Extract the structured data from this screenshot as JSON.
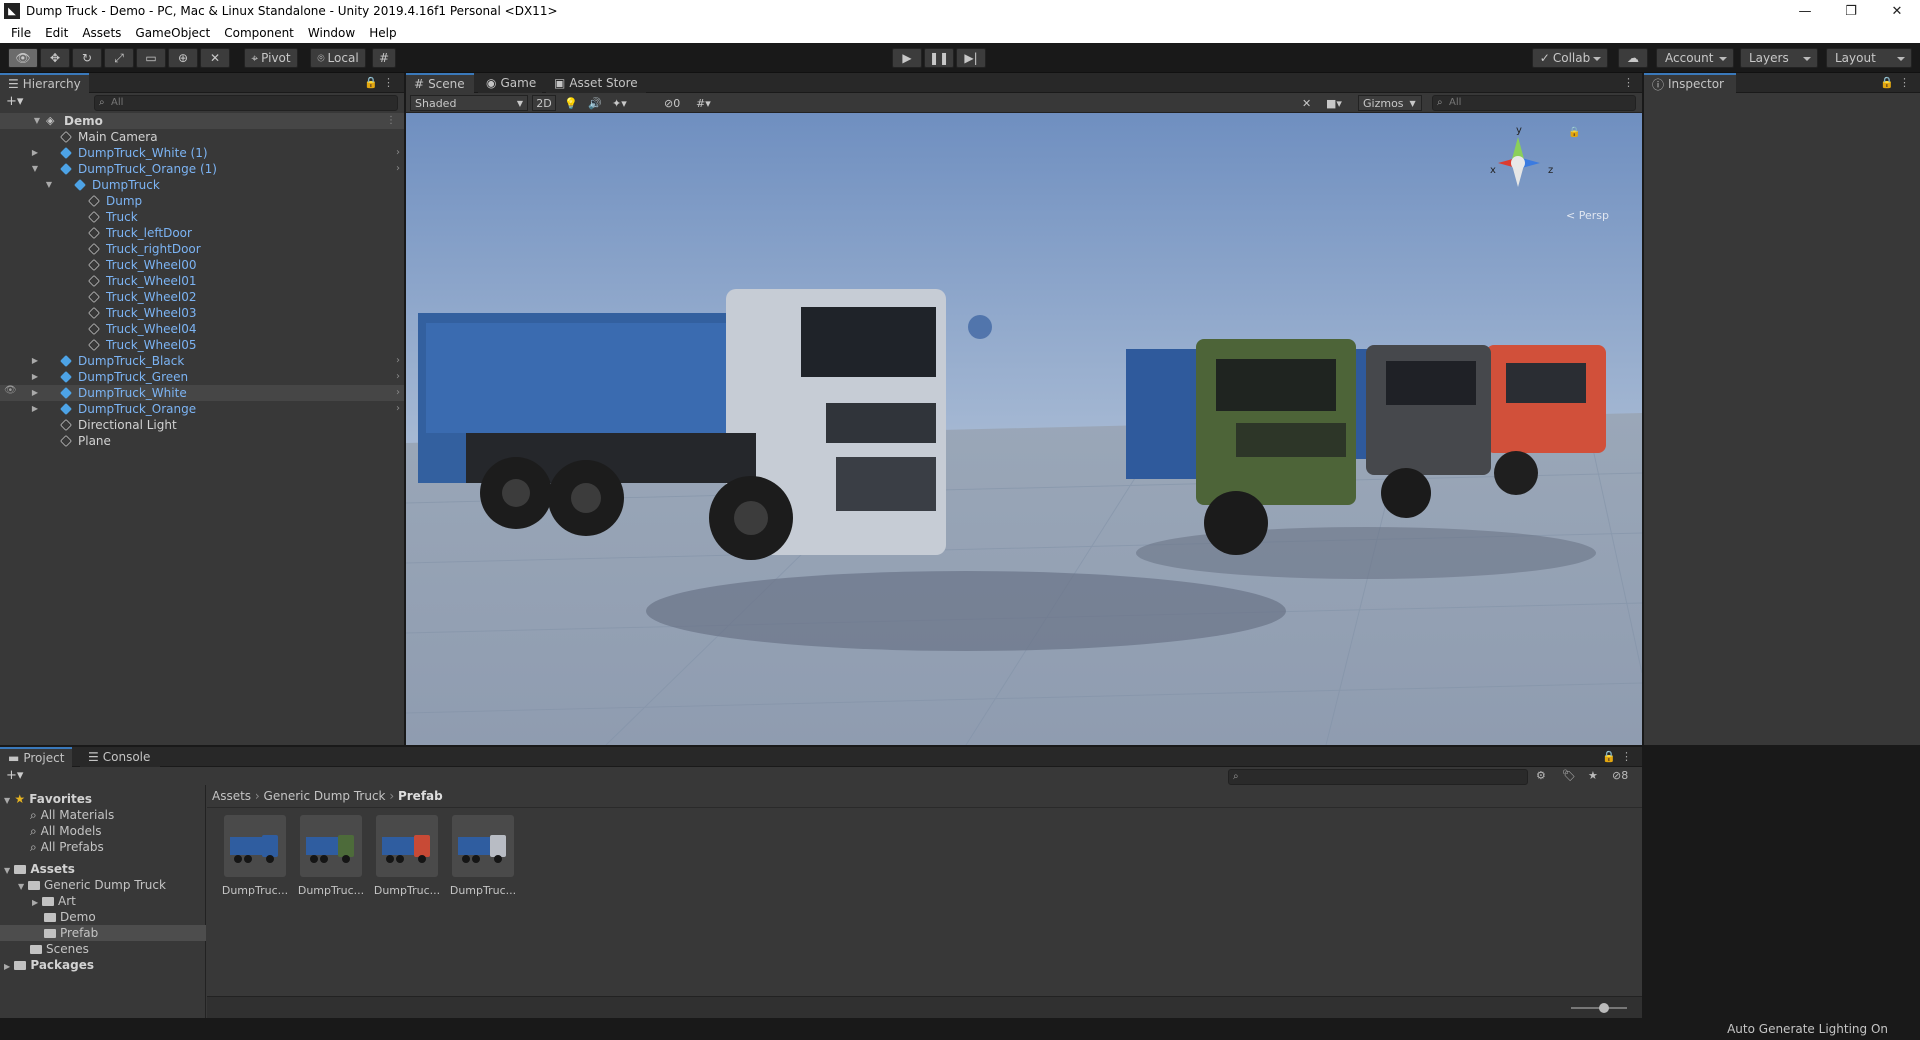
{
  "window": {
    "title": "Dump Truck - Demo - PC, Mac & Linux Standalone - Unity 2019.4.16f1 Personal <DX11>"
  },
  "menu": [
    "File",
    "Edit",
    "Assets",
    "GameObject",
    "Component",
    "Window",
    "Help"
  ],
  "toolbar": {
    "pivot": "Pivot",
    "local": "Local",
    "collab": "Collab",
    "account": "Account",
    "layers": "Layers",
    "layout": "Layout"
  },
  "hierarchy": {
    "tab": "Hierarchy",
    "search_placeholder": "All",
    "scene": "Demo",
    "items": [
      {
        "label": "Main Camera",
        "type": "go"
      },
      {
        "label": "DumpTruck_White (1)",
        "type": "prefab"
      },
      {
        "label": "DumpTruck_Orange (1)",
        "type": "prefab"
      },
      {
        "label": "DumpTruck",
        "type": "prefab"
      },
      {
        "label": "Dump",
        "type": "go"
      },
      {
        "label": "Truck",
        "type": "go"
      },
      {
        "label": "Truck_leftDoor",
        "type": "go"
      },
      {
        "label": "Truck_rightDoor",
        "type": "go"
      },
      {
        "label": "Truck_Wheel00",
        "type": "go"
      },
      {
        "label": "Truck_Wheel01",
        "type": "go"
      },
      {
        "label": "Truck_Wheel02",
        "type": "go"
      },
      {
        "label": "Truck_Wheel03",
        "type": "go"
      },
      {
        "label": "Truck_Wheel04",
        "type": "go"
      },
      {
        "label": "Truck_Wheel05",
        "type": "go"
      },
      {
        "label": "DumpTruck_Black",
        "type": "prefab"
      },
      {
        "label": "DumpTruck_Green",
        "type": "prefab"
      },
      {
        "label": "DumpTruck_White",
        "type": "prefab"
      },
      {
        "label": "DumpTruck_Orange",
        "type": "prefab"
      },
      {
        "label": "Directional Light",
        "type": "go"
      },
      {
        "label": "Plane",
        "type": "go"
      }
    ]
  },
  "scene": {
    "tabs": [
      "Scene",
      "Game",
      "Asset Store"
    ],
    "shading": "Shaded",
    "mode2d": "2D",
    "hidden_count": "0",
    "gizmos": "Gizmos",
    "search_placeholder": "All",
    "gizmo_axes": {
      "x": "x",
      "y": "y",
      "z": "z"
    },
    "persp": "< Persp"
  },
  "inspector": {
    "tab": "Inspector"
  },
  "project": {
    "tabs": [
      "Project",
      "Console"
    ],
    "favorites_label": "Favorites",
    "favorites": [
      "All Materials",
      "All Models",
      "All Prefabs"
    ],
    "assets_label": "Assets",
    "assets_tree": [
      {
        "label": "Generic Dump Truck"
      },
      {
        "label": "Art"
      },
      {
        "label": "Demo"
      },
      {
        "label": "Prefab"
      },
      {
        "label": "Scenes"
      }
    ],
    "packages_label": "Packages",
    "breadcrumb": [
      "Assets",
      "Generic Dump Truck",
      "Prefab"
    ],
    "hidden_count": "8",
    "prefabs": [
      {
        "label": "DumpTruc...",
        "accent": "#2f5da0"
      },
      {
        "label": "DumpTruc...",
        "accent": "#4d6b3a"
      },
      {
        "label": "DumpTruc...",
        "accent": "#c84a36"
      },
      {
        "label": "DumpTruc...",
        "accent": "#b8bcc4"
      }
    ]
  },
  "status": {
    "text": "Auto Generate Lighting On"
  },
  "colors": {
    "accent": "#3a79bb",
    "prefab_text": "#7cb4f4"
  }
}
